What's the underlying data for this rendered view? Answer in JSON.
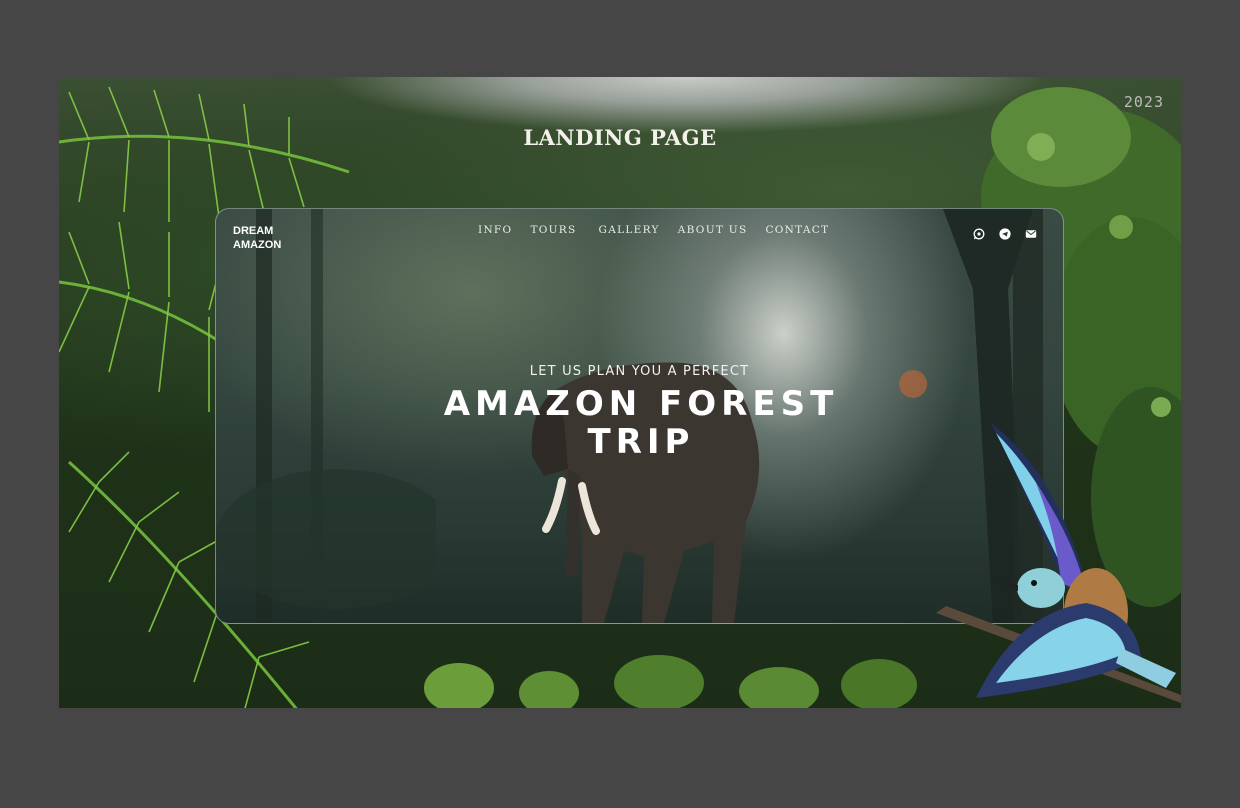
{
  "year": "2023",
  "page_title": "LANDING PAGE",
  "brand": {
    "line1": "DREAM",
    "line2": "AMAZON"
  },
  "nav": {
    "items": [
      "INFO",
      "TOURS",
      "GALLERY",
      "ABOUT US",
      "CONTACT"
    ]
  },
  "socials": [
    "whatsapp-icon",
    "telegram-icon",
    "mail-icon"
  ],
  "hero": {
    "subtitle": "LET US PLAN YOU A PERFECT",
    "title_line1": "AMAZON FOREST",
    "title_line2": "TRIP"
  },
  "colors": {
    "background": "#464646",
    "text": "#ffffff",
    "forest": "#1f3319"
  }
}
